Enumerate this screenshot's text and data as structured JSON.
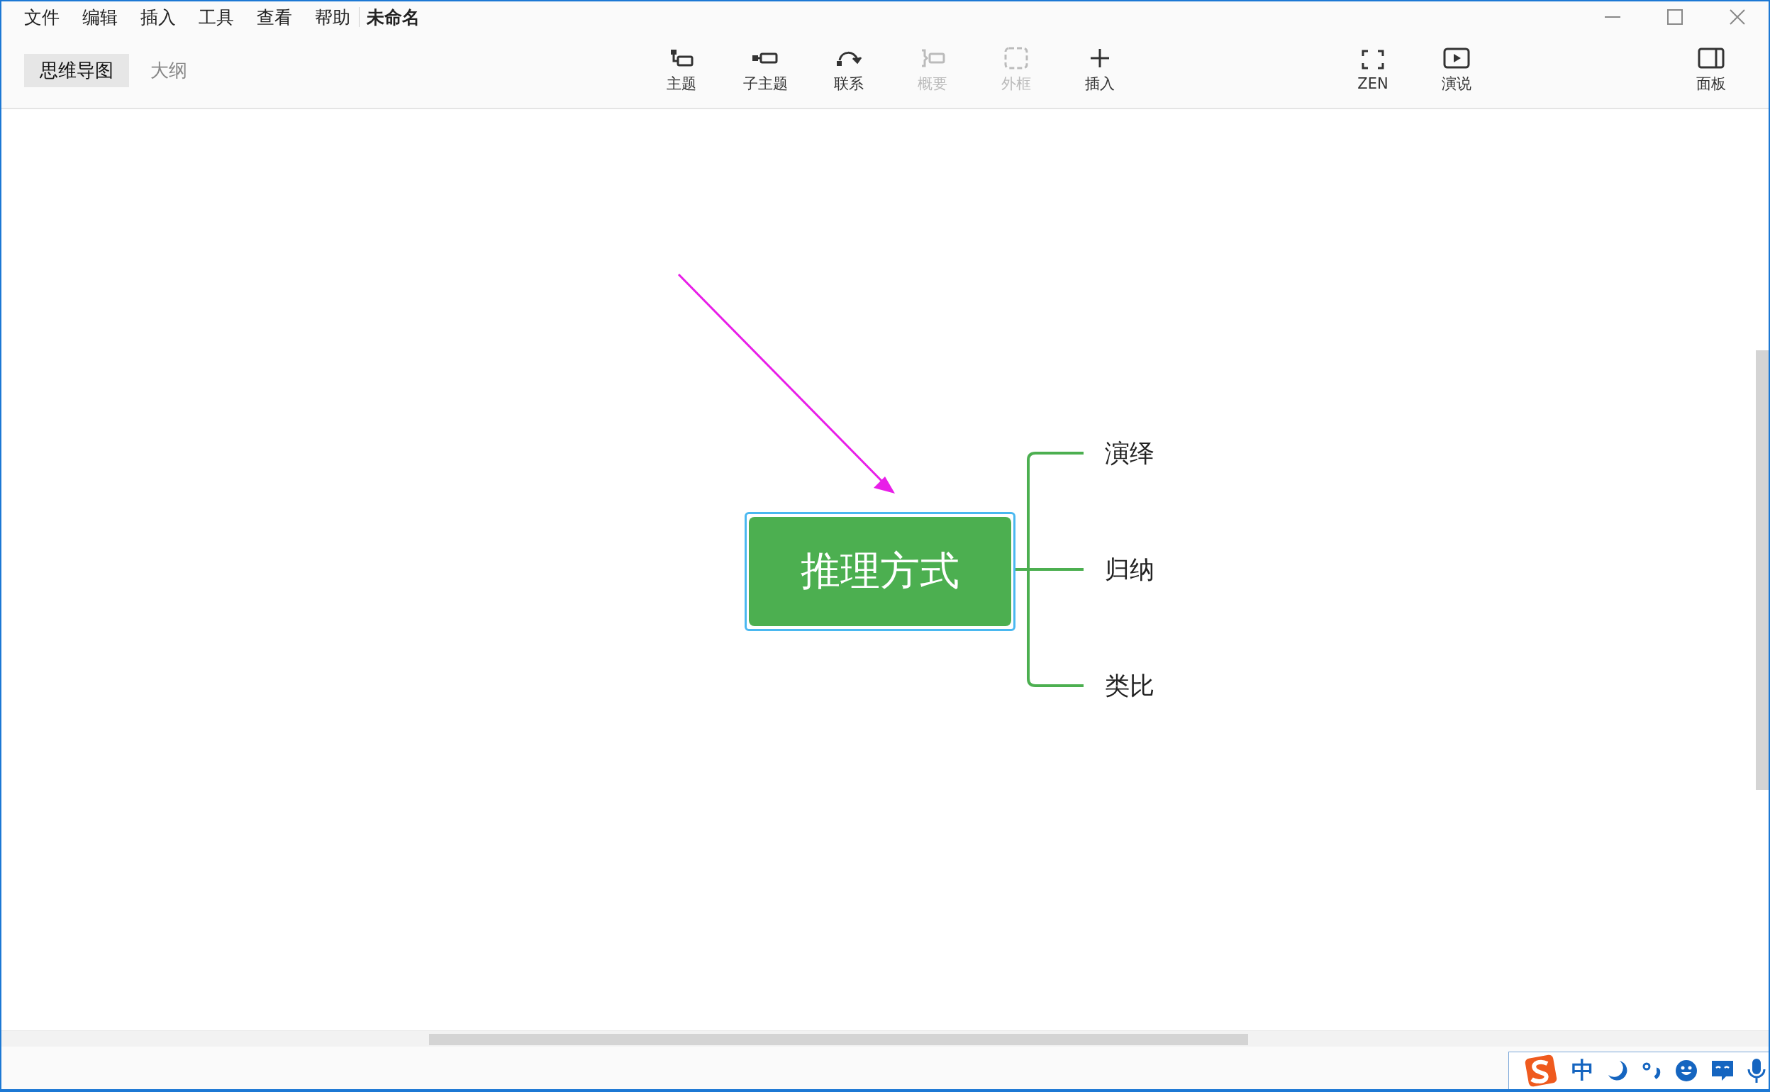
{
  "menu": [
    "文件",
    "编辑",
    "插入",
    "工具",
    "查看",
    "帮助"
  ],
  "document_title": "未命名",
  "view_tabs": [
    {
      "label": "思维导图",
      "selected": true
    },
    {
      "label": "大纲",
      "selected": false
    }
  ],
  "toolbar": [
    {
      "kind": "topic",
      "label": "主题",
      "disabled": false
    },
    {
      "kind": "subtopic",
      "label": "子主题",
      "disabled": false
    },
    {
      "kind": "relation",
      "label": "联系",
      "disabled": false
    },
    {
      "kind": "summary",
      "label": "概要",
      "disabled": true
    },
    {
      "kind": "boundary",
      "label": "外框",
      "disabled": true
    },
    {
      "kind": "insert",
      "label": "插入",
      "disabled": false
    }
  ],
  "toolbar_right": [
    {
      "kind": "zen",
      "label": "ZEN",
      "disabled": false
    },
    {
      "kind": "present",
      "label": "演说",
      "disabled": false
    }
  ],
  "panel_button": {
    "kind": "panel",
    "label": "面板",
    "disabled": false
  },
  "mind_map": {
    "central_topic": {
      "label": "推理方式",
      "selected": true
    },
    "subtopics": [
      {
        "label": "演绎"
      },
      {
        "label": "归纳"
      },
      {
        "label": "类比"
      }
    ]
  },
  "ime_bar": {
    "mode": "中"
  }
}
